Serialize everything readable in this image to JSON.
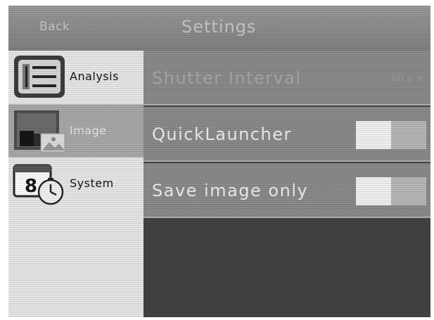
{
  "header": {
    "back_label": "Back",
    "title": "Settings"
  },
  "sidebar": {
    "items": [
      {
        "label": "Analysis",
        "icon": "analysis-list-icon",
        "selected": false
      },
      {
        "label": "Image",
        "icon": "image-icon",
        "selected": true
      },
      {
        "label": "System",
        "icon": "system-clock-icon",
        "selected": false
      }
    ],
    "system_icon_digit": "8"
  },
  "settings": {
    "rows": [
      {
        "label": "Shutter Interval",
        "value": "60 s >",
        "type": "value",
        "disabled": true
      },
      {
        "label": "QuickLauncher",
        "type": "toggle",
        "state": "off"
      },
      {
        "label": "Save image only",
        "type": "toggle",
        "state": "off"
      }
    ]
  },
  "colors": {
    "enabled_text": "#f0f0f0",
    "disabled_text": "#a8a8a8",
    "selected_sidebar": "#a9a9a9"
  }
}
